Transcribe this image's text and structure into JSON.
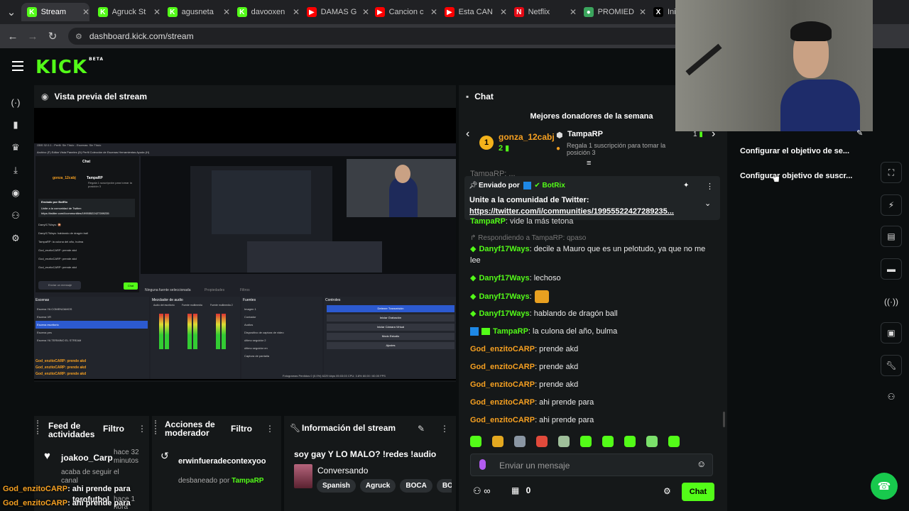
{
  "browser": {
    "tabs": [
      {
        "label": "Stream",
        "icon": "K",
        "color": "#53fc18",
        "active": true
      },
      {
        "label": "Agruck St",
        "icon": "K",
        "color": "#53fc18"
      },
      {
        "label": "agusneta",
        "icon": "K",
        "color": "#53fc18"
      },
      {
        "label": "davooxen",
        "icon": "K",
        "color": "#53fc18"
      },
      {
        "label": "DAMAS G",
        "icon": "▶",
        "color": "#ff0000"
      },
      {
        "label": "Cancion c",
        "icon": "▶",
        "color": "#ff0000"
      },
      {
        "label": "Esta CAN",
        "icon": "▶",
        "color": "#ff0000"
      },
      {
        "label": "Netflix",
        "icon": "N",
        "color": "#e50914"
      },
      {
        "label": "PROMIED",
        "icon": "●",
        "color": "#3ba55d"
      },
      {
        "label": "Inic",
        "icon": "X",
        "color": "#000000"
      }
    ],
    "url": "dashboard.kick.com/stream"
  },
  "app": {
    "logo": "KICK",
    "logo_badge": "BETA",
    "accent": "#53fc18"
  },
  "preview": {
    "title": "Vista previa del stream",
    "obs": {
      "window_title": "OBS 32.0.1 - Perfil: Sin Título - Escenas: Sin Título",
      "menu": "Archivo (F)  Editar  Vista  Paneles (D)  Perfil  Colección de Escenas  Herramientas  Ayuda (H)",
      "mini_chat_title": "Chat",
      "mini_donor1": "gonza_12cabj",
      "mini_donor2": "TampaRP",
      "mini_gift": "Regala 1 suscripción para tomar la posición 3",
      "mini_pinned_by": "Enviado por BotRix",
      "mini_pinned_text": "Unite a la comunidad de Twitter:",
      "mini_pinned_link": "https://twitter.com/i/communities/19955522427289235",
      "mini_lines": [
        "Danyf17Ways: 🎇",
        "Danyf17Ways: hablando de dragón ball",
        "TampaRP: la culona del año, bulma",
        "God_enzitoCARP: prende akd",
        "God_enzitoCARP: prende akd",
        "God_enzitoCARP: prende akd"
      ],
      "mini_input": "Enviar un mensaje",
      "mini_chat_button": "Chat",
      "no_source": "Ninguna fuente seleccionada",
      "props": "Propiedades",
      "filters": "Filtros",
      "scenes_title": "Escenas",
      "scenes": [
        "Escena YA COMENZAMOS",
        "Escena VR",
        "Escena escritorio",
        "Escena pes",
        "Escena YA TERMINO EL STREAM"
      ],
      "mixer_title": "Mezclador de audio",
      "mixer": [
        "Audio del escritorio",
        "Fuente multimedia",
        "Fuente multimedia 2"
      ],
      "sources_title": "Fuentes",
      "sources": [
        "Imagen 1",
        "Contador",
        "Audios",
        "Dispositivo de captura de video",
        "último seguidor 2",
        "último seguidor en",
        "Captura de pantalla"
      ],
      "controls_title": "Controles",
      "controls": [
        "Detener Transmisión",
        "Iniciar Grabación",
        "Iniciar Cámara Virtual",
        "Modo Estudio",
        "Ajustes"
      ],
      "status": "Fotogramas Perdidos 0 (0.0%)   6229 kbps   05:03:03   CPU: 3.8%   60.00 / 60.00 FPS",
      "overlay_lines": [
        "God_enzitoCARP: prende akd",
        "God_enzitoCARP: prende akd",
        "God_enzitoCARP: prende akd"
      ]
    }
  },
  "activity_feed": {
    "title": "Feed de actividades",
    "filter": "Filtro",
    "item_user": "joakoo_Carp",
    "item_time": "hace 32 minutos",
    "item_text": "acaba de seguir el canal",
    "item2_user": "torofutbol",
    "item2_time": "hace 1 hora"
  },
  "mod_actions": {
    "title": "Acciones de moderador",
    "filter": "Filtro",
    "item_user": "erwinfueradecontexyoo",
    "item_text": "desbaneado por",
    "item_by": "TampaRP"
  },
  "stream_info": {
    "title": "Información del stream",
    "stream_title": "soy gay Y LO MALO? !redes !audio",
    "category": "Conversando",
    "tags": [
      "Spanish",
      "Agruck",
      "BOCA",
      "BOC"
    ]
  },
  "chat": {
    "title": "Chat",
    "donors_title": "Mejores donadores de la semana",
    "donor1_rank": "1",
    "donor1_name": "gonza_12cabj",
    "donor1_count": "2",
    "donor2_name": "TampaRP",
    "donor2_note": "Regala 1 suscripción para tomar la posición 3",
    "donor3_count": "1",
    "hidden_line": "TampaRP: ...",
    "pinned_by_label": "Enviado por",
    "pinned_by": "BotRix",
    "pinned_text": "Unite a la comunidad de Twitter:",
    "pinned_link": "https://twitter.com/i/communities/19955522427289235...",
    "partial_line_user": "TampaRP",
    "partial_line_text": ": vide la más tetona",
    "reply_label": "Respondiendo a TampaRP: qpaso",
    "messages": [
      {
        "user": "Danyf17Ways",
        "text": ": decile a Mauro que es un pelotudo, ya que no me lee",
        "color": "#53fc18"
      },
      {
        "user": "Danyf17Ways",
        "text": ": lechoso",
        "color": "#53fc18"
      },
      {
        "user": "Danyf17Ways",
        "text": ":",
        "color": "#53fc18"
      },
      {
        "user": "Danyf17Ways",
        "text": ": hablando de dragón ball",
        "color": "#53fc18"
      },
      {
        "user": "TampaRP",
        "text": ": la culona del año, bulma",
        "color": "#53fc18"
      },
      {
        "user": "God_enzitoCARP",
        "text": ": prende akd",
        "color": "#f6a021"
      },
      {
        "user": "God_enzitoCARP",
        "text": ": prende akd",
        "color": "#f6a021"
      },
      {
        "user": "God_enzitoCARP",
        "text": ": prende akd",
        "color": "#f6a021"
      },
      {
        "user": "God_enzitoCARP",
        "text": ": ahi prende para",
        "color": "#f6a021"
      },
      {
        "user": "God_enzitoCARP",
        "text": ": ahi prende para",
        "color": "#f6a021"
      }
    ],
    "input_placeholder": "Enviar un mensaje",
    "infinity": "∞",
    "gift_count": "0",
    "send_button": "Chat"
  },
  "goals": {
    "item1": "Configurar el objetivo de se...",
    "item2": "Configurar objetivo de suscr..."
  },
  "overlay": {
    "line1_user": "God_enzitoCARP",
    "line1_text": ": ahi prende para",
    "line2_user": "God_enzitoCARP",
    "line2_text": ": ahi prende para"
  }
}
